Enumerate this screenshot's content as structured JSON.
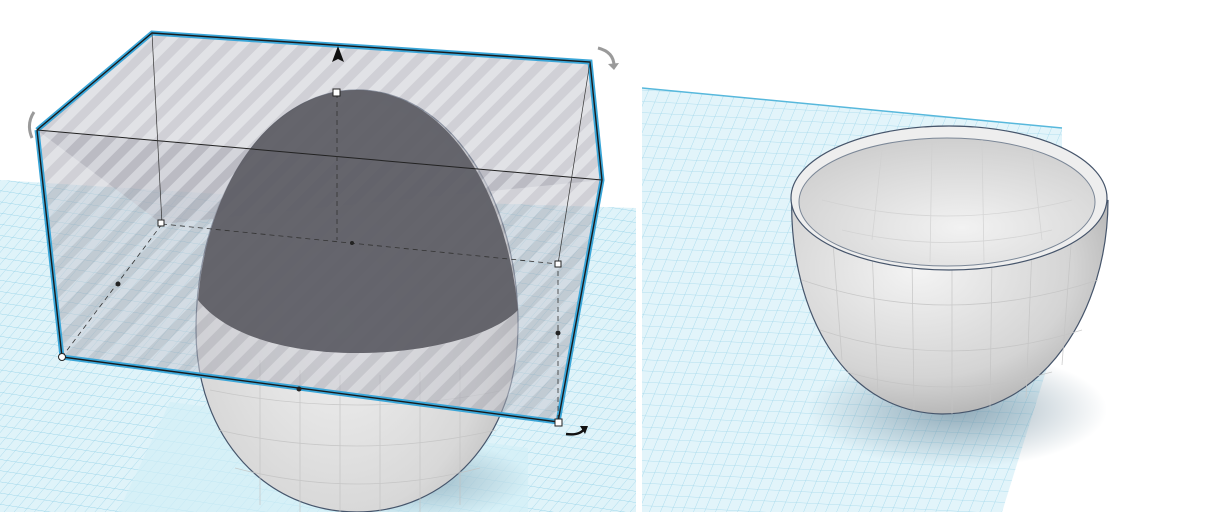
{
  "scene": {
    "left_view": {
      "description_name": "egg-with-hole-box",
      "objects": [
        "egg-shape",
        "hole-box"
      ],
      "handles": [
        "rotate-arrow-top-right",
        "rotate-arrow-left",
        "rotate-arrow-bottom-right",
        "lift-arrow"
      ]
    },
    "right_view": {
      "description_name": "egg-cup-result",
      "objects": [
        "hollow-cup-shape"
      ]
    }
  },
  "colors": {
    "grid_fill": "#d9f0f7",
    "grid_line": "#8fd0e6",
    "selection_outline": "#3aa6d8",
    "hole_fill": "#8a8c98",
    "egg_light": "#e6e6e6",
    "egg_shadow": "#9a9a9a",
    "egg_top_dark": "#5f5f66"
  }
}
